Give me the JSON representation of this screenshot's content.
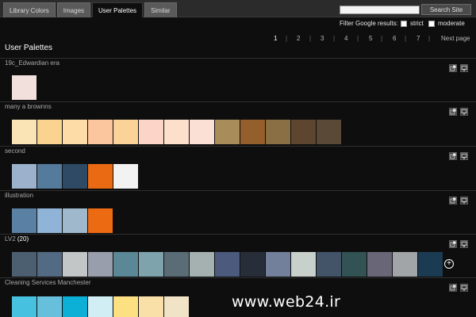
{
  "tabs": [
    {
      "label": "Library Colors",
      "active": false
    },
    {
      "label": "Images",
      "active": false
    },
    {
      "label": "User Palettes",
      "active": true
    },
    {
      "label": "Similar",
      "active": false
    }
  ],
  "search": {
    "value": "",
    "placeholder": "",
    "button_label": "Search Site"
  },
  "filter": {
    "label": "Filter Google results:",
    "strict_label": "strict",
    "moderate_label": "moderate",
    "strict_checked": false,
    "moderate_checked": false
  },
  "page_title": "User Palettes",
  "pager": {
    "pages": [
      "1",
      "2",
      "3",
      "4",
      "5",
      "6",
      "7"
    ],
    "current": "1",
    "next_label": "Next page"
  },
  "palettes": [
    {
      "name": "19c_Edwardian era",
      "count": "",
      "colors": [
        "#f2e0dc"
      ]
    },
    {
      "name": "many a brownns",
      "count": "",
      "colors": [
        "#fae4b5",
        "#f9d38f",
        "#fddca8",
        "#fbc59d",
        "#fbd297",
        "#fcd5c8",
        "#fde0cc",
        "#fbe0d5",
        "#a88c5a",
        "#955f2b",
        "#8a6f45",
        "#5e4530",
        "#5a4937"
      ]
    },
    {
      "name": "second",
      "count": "",
      "colors": [
        "#9cb2cc",
        "#547a9c",
        "#2f4a64",
        "#e96a12",
        "#f2f2f2"
      ]
    },
    {
      "name": "illustration",
      "count": "",
      "colors": [
        "#5a80a4",
        "#8fb4d8",
        "#9fb8cc",
        "#ec6a12"
      ]
    },
    {
      "name": "LV2",
      "count": "(20)",
      "colors": [
        "#4c5f71",
        "#526a84",
        "#c3c6c6",
        "#989eab",
        "#5b8896",
        "#7fa3ad",
        "#5a6d76",
        "#a4b1b0",
        "#4b5a7d",
        "#272d39",
        "#72809b",
        "#c8d0cb",
        "#435468",
        "#325253",
        "#696678",
        "#a1a5a7",
        "#1b3b52"
      ],
      "add_symbol": "+"
    },
    {
      "name": "Cleaning Services Manchester",
      "count": "",
      "colors": [
        "#46c1e0",
        "#66c0dc",
        "#0cb0d7",
        "#d2eef5",
        "#fde082",
        "#f9e0a8",
        "#f1e3c5"
      ]
    }
  ],
  "watermark": "www.web24.ir"
}
